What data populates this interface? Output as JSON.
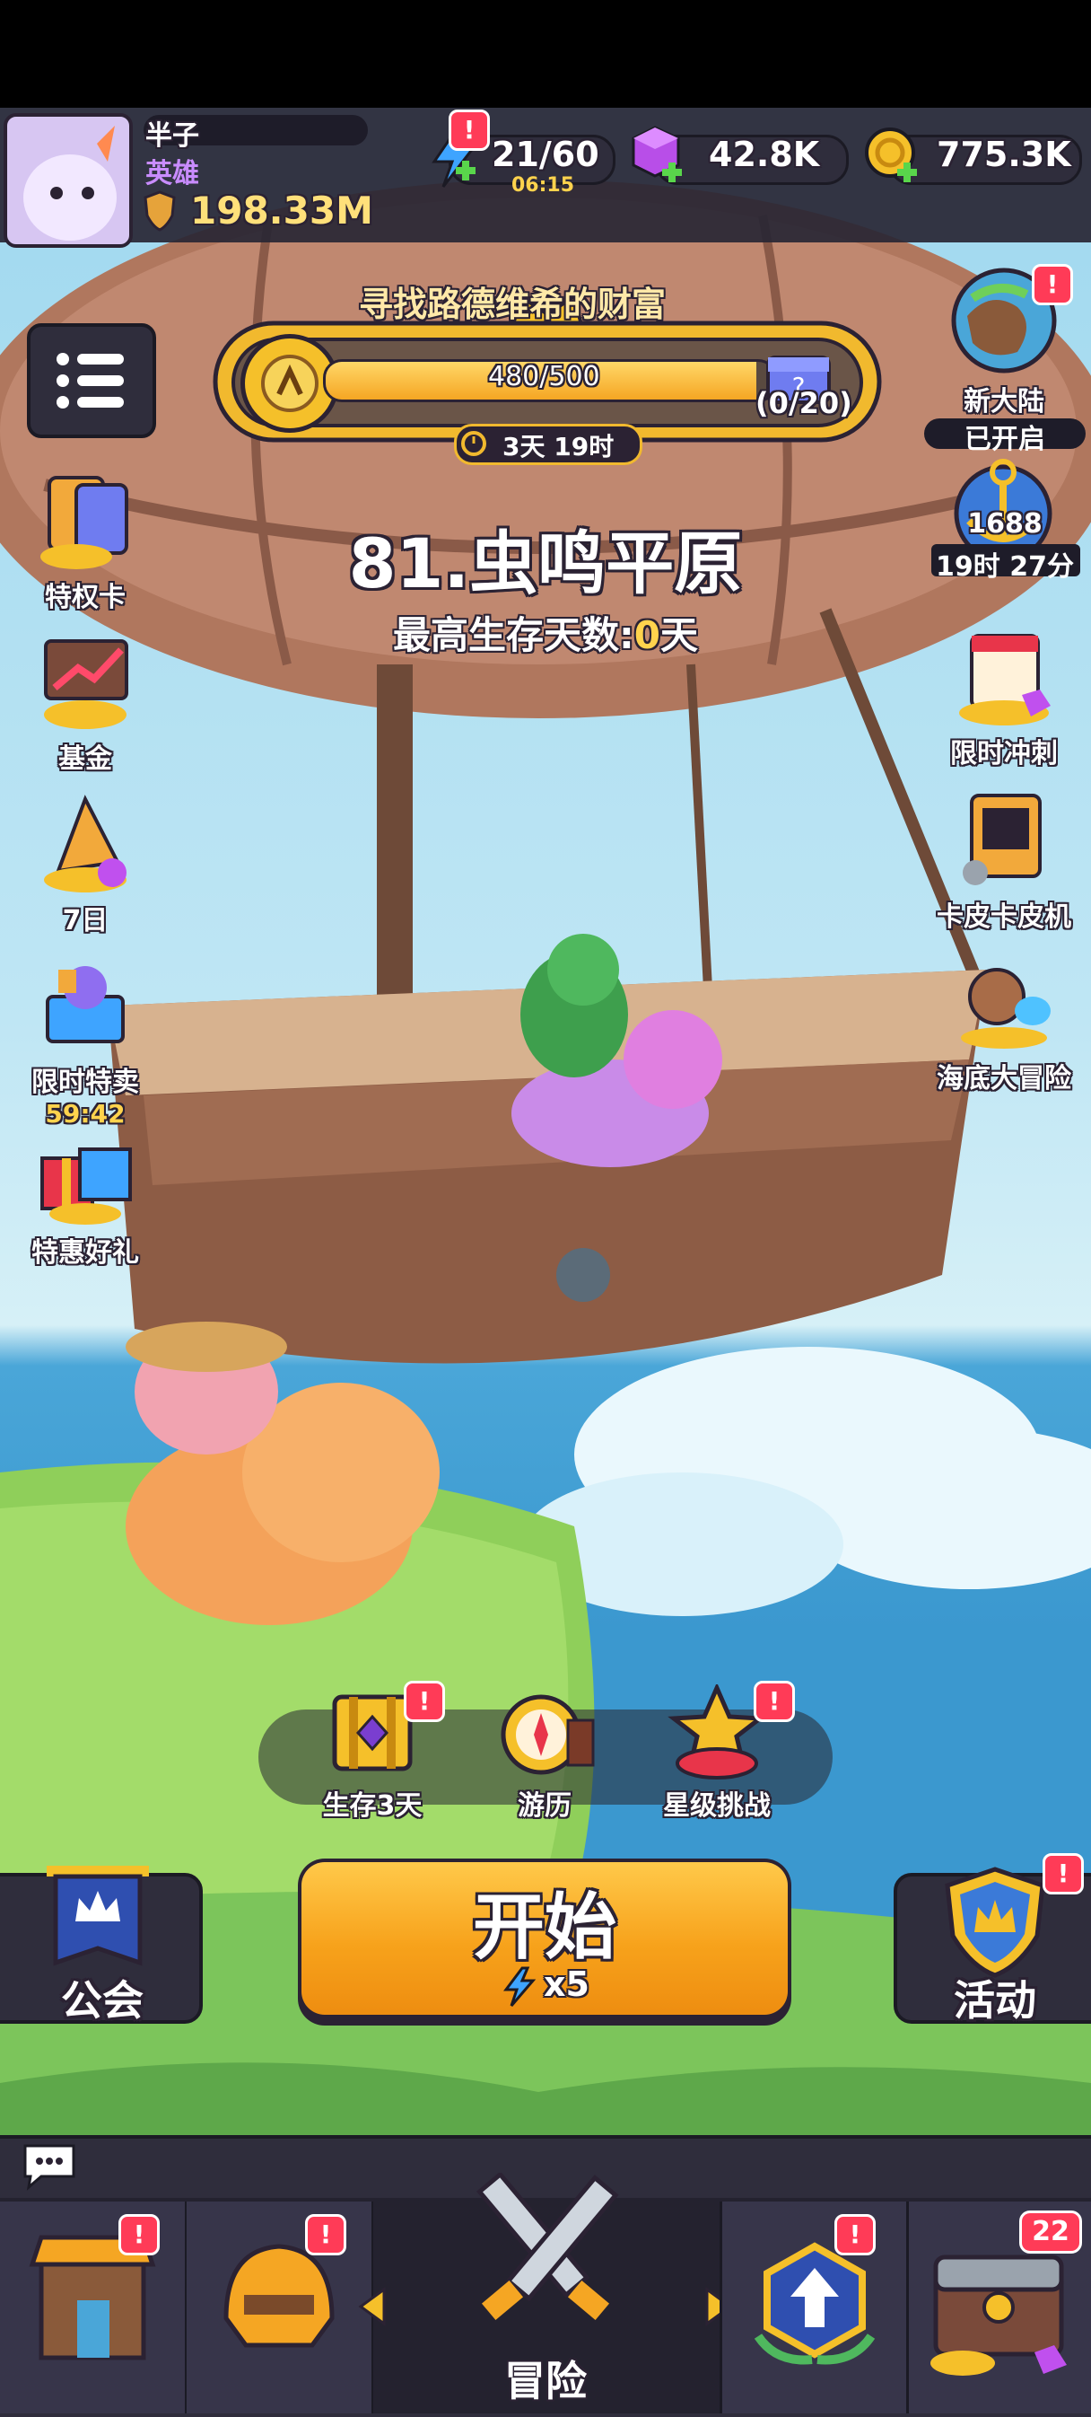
{
  "player": {
    "name": "半子",
    "title": "英雄",
    "power": "198.33M"
  },
  "currency": {
    "energy": "21/60",
    "energy_timer": "06:15",
    "gems": "42.8K",
    "coins": "775.3K"
  },
  "quest": {
    "title": "寻找路德维希的财富",
    "progress_text": "480/500",
    "progress": 0.96,
    "chest_count": "(0/20)",
    "time_left": "3天 19时"
  },
  "stage": {
    "name": "81.虫鸣平原",
    "best_label": "最高生存天数:",
    "best_value": "0",
    "best_unit": "天"
  },
  "left_menu": [
    {
      "label": "特权卡"
    },
    {
      "label": "基金"
    },
    {
      "label": "7日"
    },
    {
      "label": "限时特卖",
      "timer": "59:42"
    },
    {
      "label": "特惠好礼"
    }
  ],
  "right_menu": {
    "new_continent": "新大陆",
    "opened": "已开启",
    "event_number": "1688",
    "event_timer": "19时 27分",
    "items": [
      {
        "label": "限时冲刺"
      },
      {
        "label": "卡皮卡皮机"
      },
      {
        "label": "海底大冒险"
      }
    ]
  },
  "mid_buttons": [
    {
      "label": "生存3天"
    },
    {
      "label": "游历"
    },
    {
      "label": "星级挑战"
    }
  ],
  "guild": "公会",
  "activity": "活动",
  "start": {
    "label": "开始",
    "cost": "x5"
  },
  "bottom_nav": {
    "center_label": "冒险",
    "chest_count": "22"
  },
  "colors": {
    "accent_orange": "#f7a21b",
    "badge_red": "#ff3b57",
    "gem_purple": "#b84ee8",
    "gold": "#f5c02a"
  }
}
